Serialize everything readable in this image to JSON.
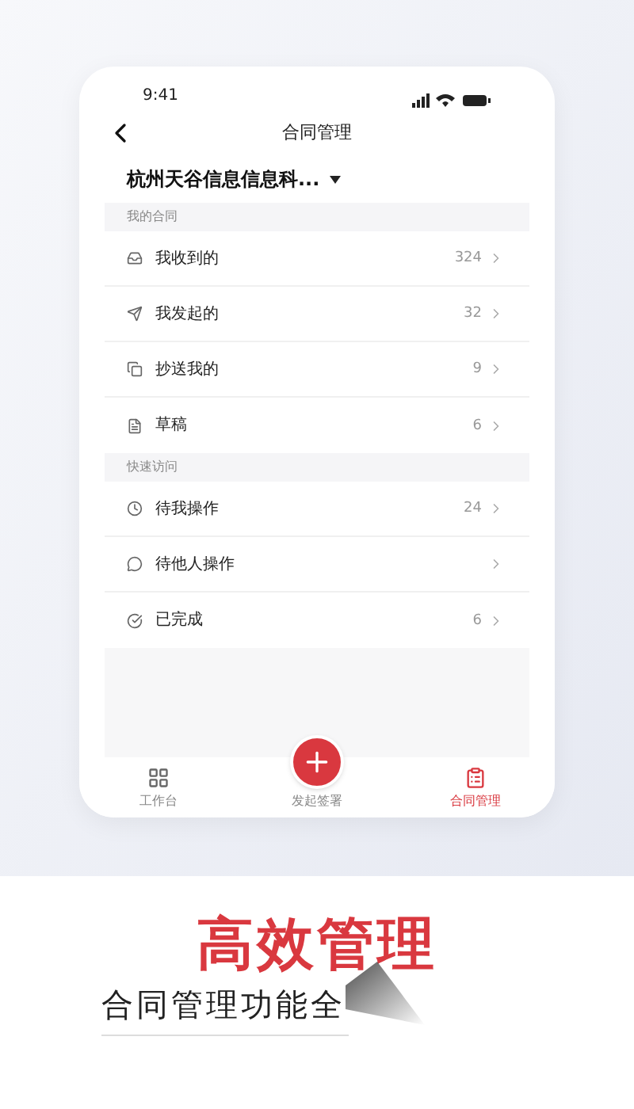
{
  "status_bar": {
    "time": "9:41"
  },
  "nav": {
    "title": "合同管理"
  },
  "company": {
    "name": "杭州天谷信息信息科..."
  },
  "sections": [
    {
      "title": "我的合同",
      "items": [
        {
          "label": "我收到的",
          "count": "324"
        },
        {
          "label": "我发起的",
          "count": "32"
        },
        {
          "label": "抄送我的",
          "count": "9"
        },
        {
          "label": "草稿",
          "count": "6"
        }
      ]
    },
    {
      "title": "快速访问",
      "items": [
        {
          "label": "待我操作",
          "count": "24"
        },
        {
          "label": "待他人操作"
        },
        {
          "label": "已完成",
          "count": "6"
        }
      ]
    }
  ],
  "tab_bar": [
    {
      "label": "工作台",
      "kind": "tab",
      "selected": false
    },
    {
      "label": "发起签署",
      "kind": "fab",
      "selected": false
    },
    {
      "label": "合同管理",
      "kind": "tab",
      "selected": true
    }
  ],
  "promo": {
    "headline": "高效管理",
    "subtitle": "合同管理功能全"
  }
}
